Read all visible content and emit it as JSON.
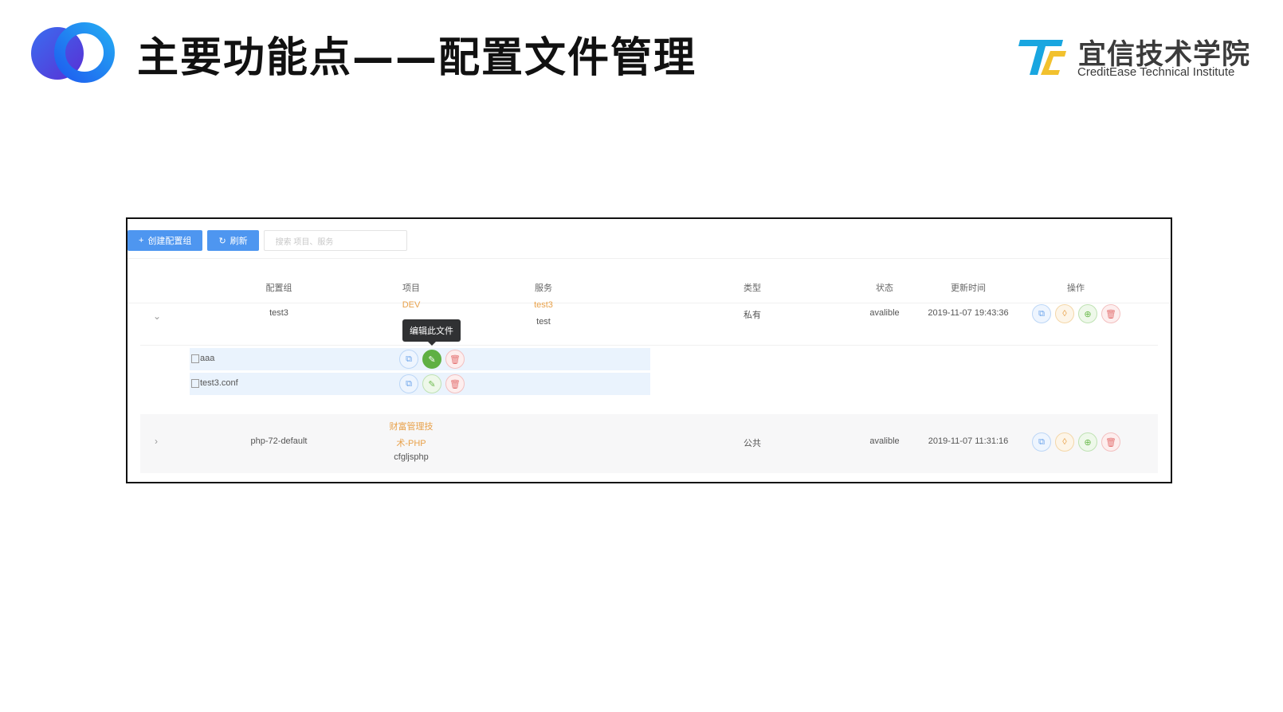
{
  "slide": {
    "title": "主要功能点——配置文件管理",
    "brand": {
      "name_cn": "宜信技术学院",
      "name_en": "CreditEase Technical Institute"
    },
    "colors": {
      "logo_blue": "#2f6bf2",
      "logo_purple": "#5b3fd8",
      "brand_cyan": "#19a6e0",
      "brand_yellow": "#f2c12e"
    }
  },
  "app": {
    "toolbar": {
      "create_label": "创建配置组",
      "create_icon": "plus-icon",
      "refresh_label": "刷新",
      "refresh_icon": "refresh-icon",
      "search_placeholder": "搜索 项目、服务"
    },
    "table": {
      "headers": {
        "group": "配置组",
        "project": "项目",
        "service": "服务",
        "type": "类型",
        "status": "状态",
        "updated": "更新时间",
        "actions": "操作"
      },
      "rows": [
        {
          "expanded": true,
          "group": "test3",
          "project": "DEV",
          "service_line1": "test3",
          "service_line2": "test",
          "type": "私有",
          "status": "avalible",
          "updated": "2019-11-07 19:43:36",
          "files": [
            {
              "name": "aaa"
            },
            {
              "name": "test3.conf"
            }
          ]
        },
        {
          "expanded": false,
          "group": "php-72-default",
          "project_line1": "财富管理技",
          "project_line2": "术-PHP",
          "project_line3": "cfgljsphp",
          "type": "公共",
          "status": "avalible",
          "updated": "2019-11-07 11:31:16"
        }
      ]
    },
    "tooltip": "编辑此文件",
    "action_icons": [
      "copy-icon",
      "bulb-icon",
      "plus-circle-icon",
      "trash-icon"
    ],
    "file_action_icons": [
      "copy-icon",
      "edit-icon",
      "trash-icon"
    ]
  }
}
